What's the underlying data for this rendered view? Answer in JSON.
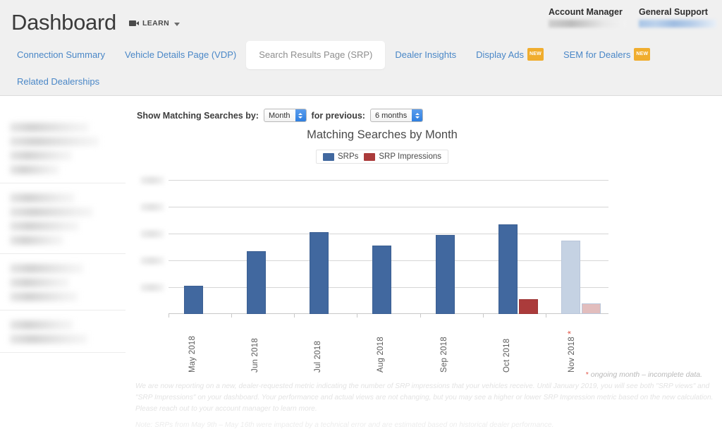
{
  "header": {
    "app_title": "Dashboard",
    "learn_label": "LEARN",
    "learn_icon": "video-camera-icon",
    "caret_icon": "chevron-down-icon",
    "contacts": [
      {
        "title": "Account Manager",
        "value_redacted": true,
        "style": "gray"
      },
      {
        "title": "General Support",
        "value_redacted": true,
        "style": "blue"
      }
    ]
  },
  "nav": {
    "items": [
      {
        "label": "Connection Summary",
        "active": false,
        "badge": null
      },
      {
        "label": "Vehicle Details Page (VDP)",
        "active": false,
        "badge": null
      },
      {
        "label": "Search Results Page (SRP)",
        "active": true,
        "badge": null
      },
      {
        "label": "Dealer Insights",
        "active": false,
        "badge": null
      },
      {
        "label": "Display Ads",
        "active": false,
        "badge": "NEW"
      },
      {
        "label": "SEM for Dealers",
        "active": false,
        "badge": "NEW"
      },
      {
        "label": "Related Dealerships",
        "active": false,
        "badge": null
      }
    ]
  },
  "sidebar": {
    "redacted": true,
    "note": "sidebar content is blurred/redacted in the screenshot"
  },
  "controls": {
    "show_by_label": "Show Matching Searches by:",
    "show_by_value": "Month",
    "for_previous_label": "for previous:",
    "for_previous_value": "6 months"
  },
  "footnotes": {
    "ongoing": "ongoing month – incomplete data.",
    "ongoing_star": "*",
    "disclaimer": "We are now reporting on a new, dealer-requested metric indicating the number of SRP impressions that your vehicles receive. Until January 2019, you will see both \"SRP views\" and \"SRP Impressions\" on your dashboard. Your performance and actual views are not changing, but you may see a higher or lower SRP Impression metric based on the new calculation. Please reach out to your account manager to learn more.",
    "note": "Note: SRPs from May 9th – May 16th were impacted by a technical error and are estimated based on historical dealer performance."
  },
  "chart_data": {
    "type": "bar",
    "title": "Matching Searches by Month",
    "xlabel": "",
    "ylabel": "",
    "grid": true,
    "legend_position": "top-center",
    "ylim": [
      0,
      5
    ],
    "yticks_redacted": true,
    "ytick_count": 5,
    "categories": [
      "May 2018",
      "Jun 2018",
      "Jul 2018",
      "Aug 2018",
      "Sep 2018",
      "Oct 2018",
      "Nov 2018 *"
    ],
    "incomplete_category": "Nov 2018 *",
    "series": [
      {
        "name": "SRPs",
        "color": "#41689f",
        "faded_color": "#c5d2e3",
        "values": [
          1.05,
          2.35,
          3.05,
          2.55,
          2.95,
          3.35,
          2.75
        ]
      },
      {
        "name": "SRP Impressions",
        "color": "#ab3b3b",
        "faded_color": "#e2bdbd",
        "values": [
          null,
          null,
          null,
          null,
          null,
          0.55,
          0.4
        ]
      }
    ],
    "legend": [
      {
        "label": "SRPs",
        "color": "#41689f"
      },
      {
        "label": "SRP Impressions",
        "color": "#ab3b3b"
      }
    ]
  }
}
